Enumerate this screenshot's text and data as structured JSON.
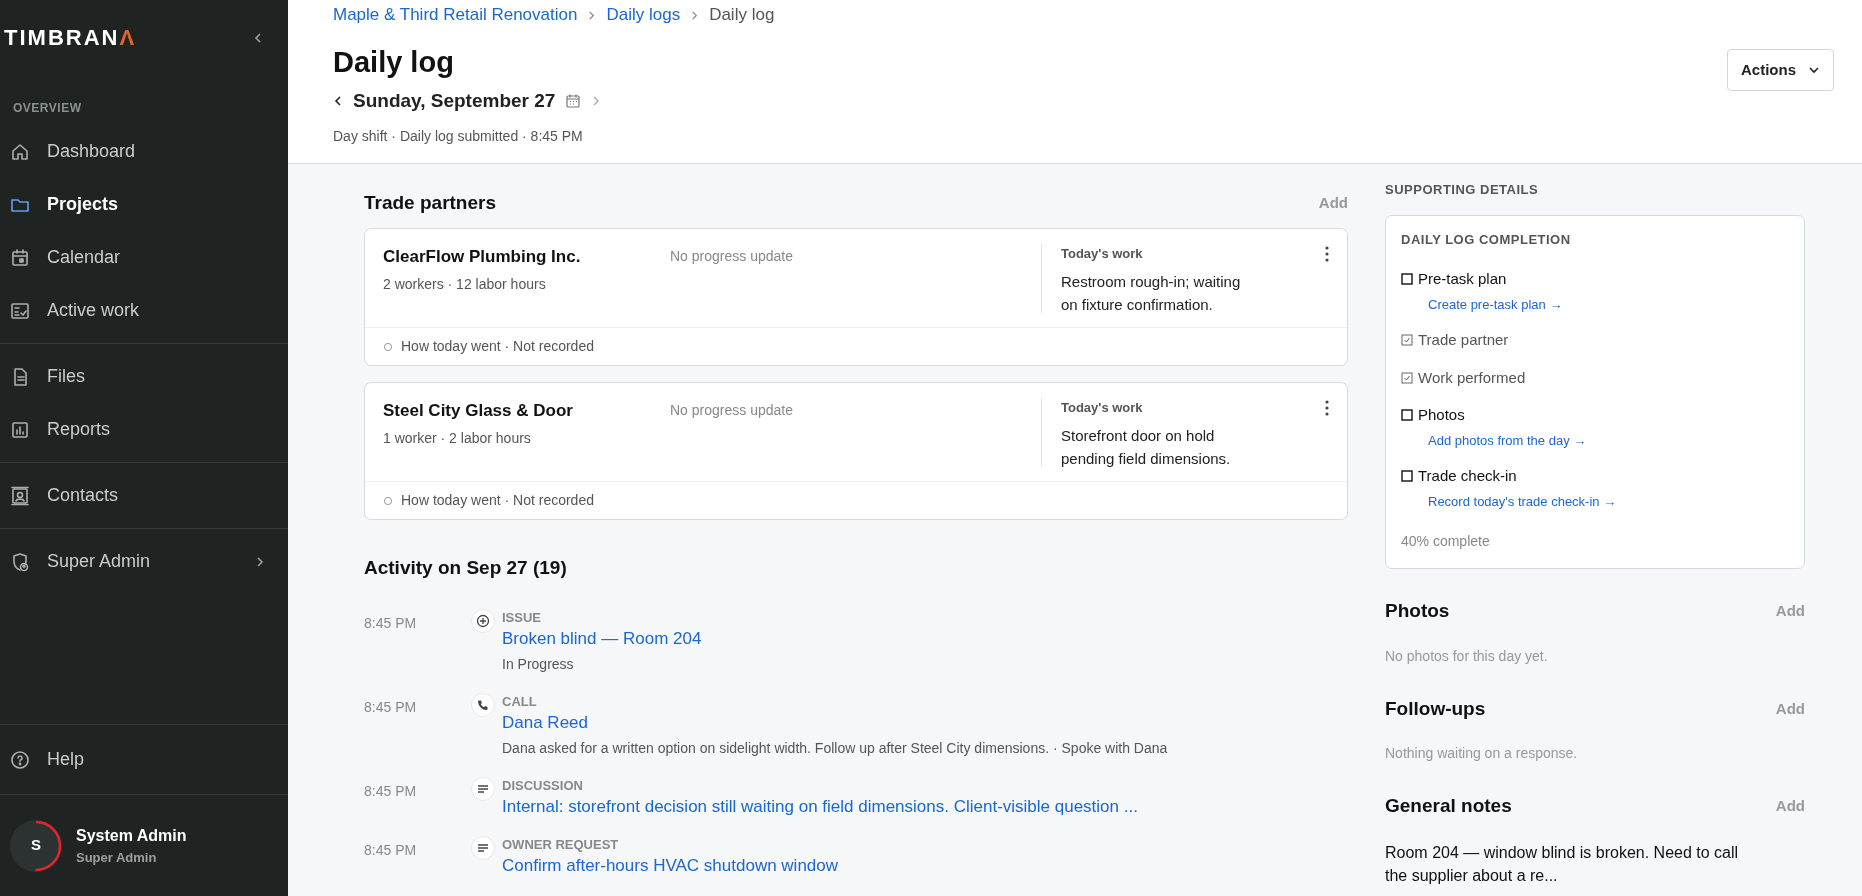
{
  "sidebar": {
    "logo": {
      "text": "TIMBRAN",
      "accent": "Λ"
    },
    "section_label": "OVERVIEW",
    "groups": [
      [
        {
          "label": "Dashboard",
          "selected": false,
          "has_submenu": false
        },
        {
          "label": "Projects",
          "selected": true,
          "has_submenu": false
        },
        {
          "label": "Calendar",
          "selected": false,
          "has_submenu": false
        },
        {
          "label": "Active work",
          "selected": false,
          "has_submenu": false
        }
      ],
      [
        {
          "label": "Files",
          "selected": false,
          "has_submenu": false
        },
        {
          "label": "Reports",
          "selected": false,
          "has_submenu": false
        }
      ],
      [
        {
          "label": "Contacts",
          "selected": false,
          "has_submenu": false
        }
      ],
      [
        {
          "label": "Super Admin",
          "selected": false,
          "has_submenu": true
        }
      ]
    ],
    "help": "Help",
    "user": {
      "initial": "S",
      "name": "System Admin",
      "role": "Super Admin",
      "level": 0.5
    }
  },
  "breadcrumbs": [
    "Maple & Third Retail Renovation",
    "Daily logs",
    "Daily log"
  ],
  "title": "Daily log",
  "date": "Sunday, September 27",
  "subtitle": "Day shift · Daily log submitted · 8:45 PM",
  "actions_button": "Actions",
  "trade_partners": {
    "title": "Trade partners",
    "add": "Add",
    "cards": [
      {
        "name": "ClearFlow Plumbing Inc.",
        "meta": "2 workers · 12 labor hours",
        "progress": "No progress update",
        "work_label": "Today's work",
        "work": "Restroom rough-in; waiting on fixture confirmation.",
        "footer": "How today went · Not recorded"
      },
      {
        "name": "Steel City Glass & Door",
        "meta": "1 worker · 2 labor hours",
        "progress": "No progress update",
        "work_label": "Today's work",
        "work": "Storefront door on hold pending field dimensions.",
        "footer": "How today went · Not recorded"
      }
    ]
  },
  "activity": {
    "title": "Activity on Sep 27 (19)",
    "items": [
      {
        "time": "8:45 PM",
        "kind": "issue",
        "type": "ISSUE",
        "title": "Broken blind — Room 204",
        "detail": "In Progress"
      },
      {
        "time": "8:45 PM",
        "kind": "call",
        "type": "CALL",
        "title": "Dana Reed",
        "detail": "Dana asked for a written option on sidelight width. Follow up after Steel City dimensions. · Spoke with Dana"
      },
      {
        "time": "8:45 PM",
        "kind": "note",
        "type": "DISCUSSION",
        "title": "Internal: storefront decision still waiting on field dimensions. Client-visible question ..."
      },
      {
        "time": "8:45 PM",
        "kind": "note",
        "type": "OWNER REQUEST",
        "title": "Confirm after-hours HVAC shutdown window"
      }
    ]
  },
  "supporting": {
    "label": "SUPPORTING DETAILS",
    "completion": {
      "title": "DAILY LOG COMPLETION",
      "items": [
        {
          "label": "Pre-task plan",
          "checked": false,
          "link": "Create pre-task plan →"
        },
        {
          "label": "Trade partner",
          "checked": true
        },
        {
          "label": "Work performed",
          "checked": true
        },
        {
          "label": "Photos",
          "checked": false,
          "link": "Add photos from the day →"
        },
        {
          "label": "Trade check-in",
          "checked": false,
          "link": "Record today's trade check-in →"
        }
      ],
      "summary": "40% complete"
    },
    "sections": [
      {
        "title": "Photos",
        "add": "Add",
        "text": "No photos for this day yet.",
        "kind": "empty"
      },
      {
        "title": "Follow-ups",
        "add": "Add",
        "text": "Nothing waiting on a response.",
        "kind": "empty"
      },
      {
        "title": "General notes",
        "add": "Add",
        "text": "Room 204 — window blind is broken. Need to call the supplier about a re...",
        "kind": "note"
      }
    ]
  }
}
